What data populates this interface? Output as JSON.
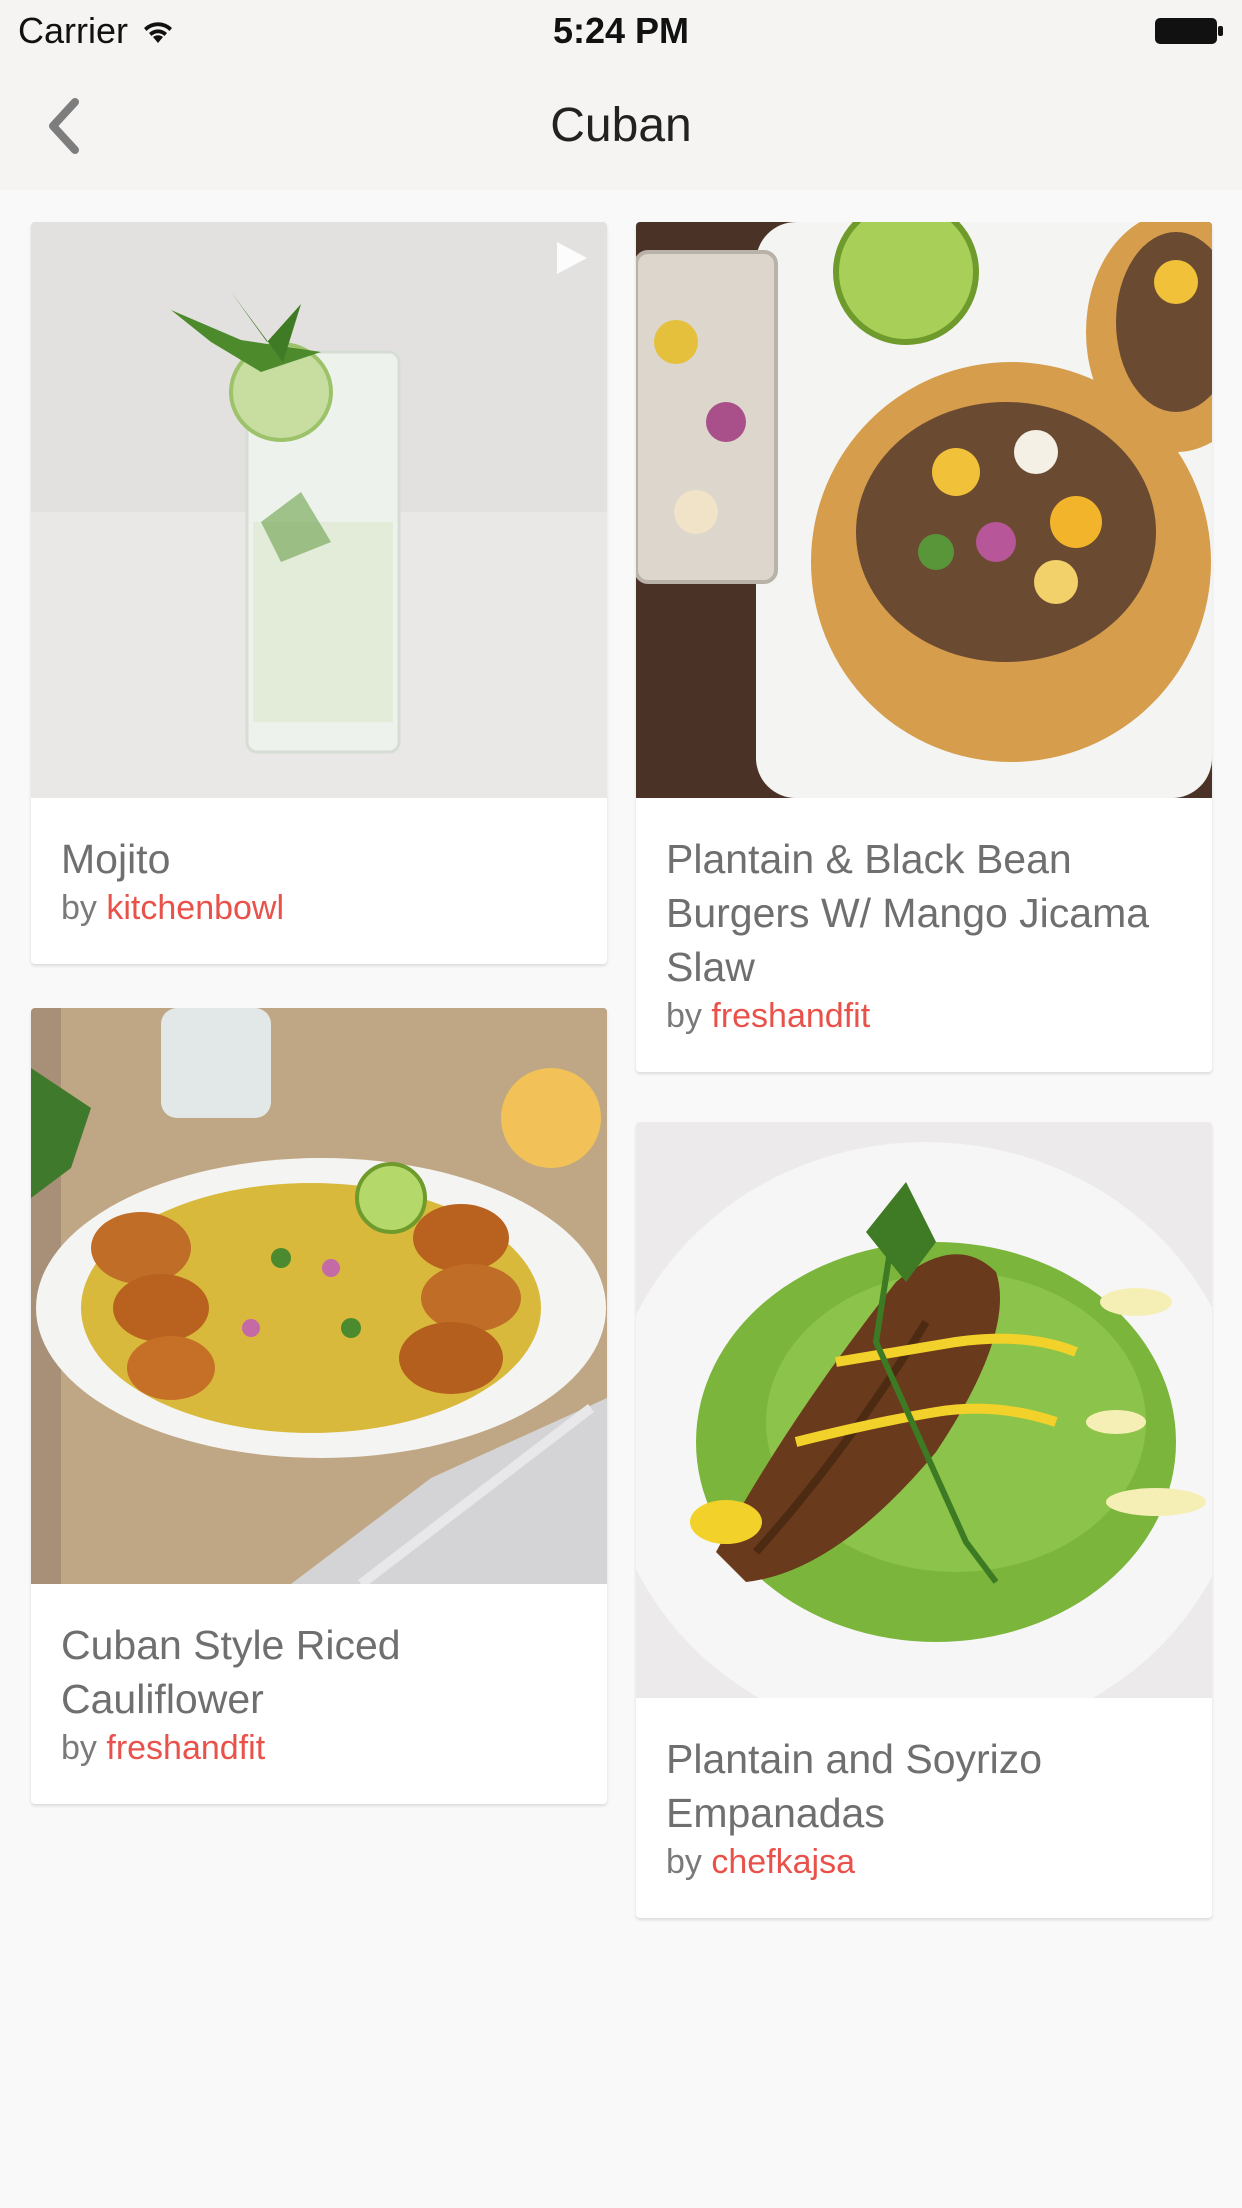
{
  "status_bar": {
    "carrier": "Carrier",
    "time": "5:24 PM"
  },
  "nav": {
    "title": "Cuban",
    "back_icon": "chevron-left-icon"
  },
  "colors": {
    "author_accent": "#e8524a",
    "title_text": "#6f6f6f",
    "bar_bg": "#f5f4f2",
    "page_bg": "#f9f9f9"
  },
  "recipes": [
    {
      "title": "Mojito",
      "by": "by",
      "author": "kitchenbowl",
      "has_video": true
    },
    {
      "title": "Plantain & Black Bean Burgers W/ Mango Jicama Slaw",
      "by": "by",
      "author": "freshandfit"
    },
    {
      "title": "Cuban Style Riced Cauliflower",
      "by": "by",
      "author": "freshandfit"
    },
    {
      "title": "Plantain and Soyrizo Empanadas",
      "by": "by",
      "author": "chefkajsa"
    }
  ]
}
